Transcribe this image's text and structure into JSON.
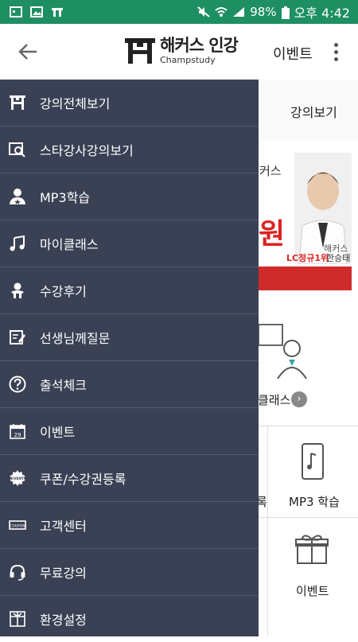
{
  "status_bar": {
    "battery": "98%",
    "time": "오후 4:42"
  },
  "app_bar": {
    "logo_title": "해커스 인강",
    "logo_subtitle": "Champstudy",
    "event_label": "이벤트"
  },
  "background_page": {
    "tab_label": "강의보기",
    "banner_text": "커스",
    "banner_big": "원",
    "banner_brand": "해커스",
    "banner_rank": "LC정규1위",
    "banner_teacher": "한승태",
    "class_link": "클래스",
    "grid_mp3": "MP3 학습",
    "grid_left_fragment": "록",
    "grid_event": "이벤트"
  },
  "drawer": {
    "items": [
      {
        "label": "강의전체보기",
        "icon": "lecture-all-icon"
      },
      {
        "label": "스타강사강의보기",
        "icon": "star-teacher-icon"
      },
      {
        "label": "MP3학습",
        "icon": "mp3-study-icon"
      },
      {
        "label": "마이클래스",
        "icon": "music-note-icon"
      },
      {
        "label": "수강후기",
        "icon": "review-icon"
      },
      {
        "label": "선생님께질문",
        "icon": "question-edit-icon"
      },
      {
        "label": "출석체크",
        "icon": "help-circle-icon"
      },
      {
        "label": "이벤트",
        "icon": "calendar-icon"
      },
      {
        "label": "쿠폰/수강권등록",
        "icon": "event-badge-icon"
      },
      {
        "label": "고객센터",
        "icon": "coupon-icon"
      },
      {
        "label": "무료강의",
        "icon": "headset-icon"
      },
      {
        "label": "환경설정",
        "icon": "settings-box-icon"
      }
    ]
  },
  "colors": {
    "status_bar": "#1e8f62",
    "drawer_bg": "#3a4154",
    "accent_red": "#d22222"
  }
}
